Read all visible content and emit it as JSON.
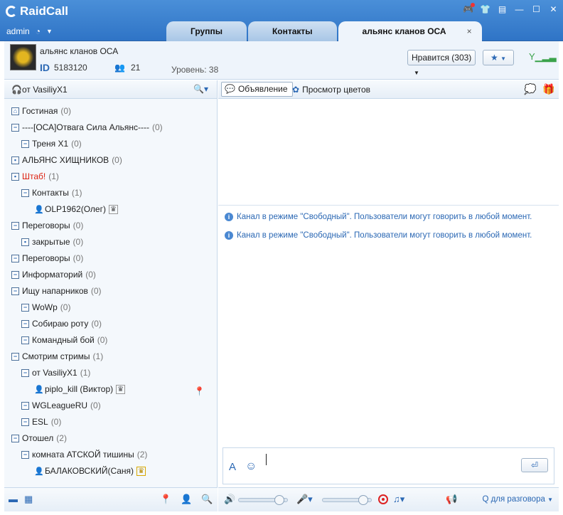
{
  "app": {
    "name": "RaidCall",
    "user": "admin"
  },
  "tabs": [
    {
      "label": "Группы"
    },
    {
      "label": "Контакты"
    },
    {
      "label": "альянс кланов ОСА",
      "close": "×"
    }
  ],
  "channel": {
    "name": "альянс кланов ОСА",
    "id_label": "ID",
    "id": "5183120",
    "members": "21",
    "level": "Уровень: 38",
    "likes": "Нравится (303)"
  },
  "left": {
    "header": "от VasiliyX1",
    "tree": [
      {
        "name": "Гостиная",
        "count": "(0)",
        "icon": "home"
      },
      {
        "name": "----[ОСА]Отвага Сила Альянс----",
        "count": "(0)",
        "icon": "minus"
      },
      {
        "name": "Треня Х1",
        "count": "(0)",
        "icon": "minus"
      },
      {
        "name": "АЛЬЯНС ХИЩНИКОВ",
        "count": "(0)",
        "icon": "lock"
      },
      {
        "name": "Штаб!",
        "count": "(1)",
        "icon": "lock"
      },
      {
        "name": "Контакты",
        "count": "(1)",
        "icon": "minus"
      },
      {
        "name": "OLP1962(Олег)",
        "count": "",
        "icon": "user"
      },
      {
        "name": "Переговоры",
        "count": "(0)",
        "icon": "minus"
      },
      {
        "name": "закрытые",
        "count": "(0)",
        "icon": "lock"
      },
      {
        "name": "Переговоры",
        "count": "(0)",
        "icon": "minus"
      },
      {
        "name": "Информаторий",
        "count": "(0)",
        "icon": "minus"
      },
      {
        "name": "Ищу напарников",
        "count": "(0)",
        "icon": "minus"
      },
      {
        "name": "WoWp",
        "count": "(0)",
        "icon": "minus"
      },
      {
        "name": "Собираю роту",
        "count": "(0)",
        "icon": "minus"
      },
      {
        "name": "Командный бой",
        "count": "(0)",
        "icon": "minus"
      },
      {
        "name": "Смотрим стримы",
        "count": "(1)",
        "icon": "minus"
      },
      {
        "name": "от VasiliyX1",
        "count": "(1)",
        "icon": "minus"
      },
      {
        "name": "piplo_kill (Виктор)",
        "count": "",
        "icon": "user"
      },
      {
        "name": "WGLeagueRU",
        "count": "(0)",
        "icon": "minus"
      },
      {
        "name": "ESL",
        "count": "(0)",
        "icon": "minus"
      },
      {
        "name": "Отошел",
        "count": "(2)",
        "icon": "minus"
      },
      {
        "name": "комната АТСКОЙ тишины",
        "count": "(2)",
        "icon": "minus"
      },
      {
        "name": "БАЛАКОВСКИЙ(Саня)",
        "count": "",
        "icon": "user"
      }
    ]
  },
  "right": {
    "announcement": "Объявление",
    "flowers": "Просмотр цветов",
    "messages": [
      "Канал в режиме \"Свободный\". Пользователи могут говорить в любой момент.",
      "Канал в режиме \"Свободный\". Пользователи могут говорить в любой момент."
    ],
    "speak_mode": "Q для разговора",
    "volume_level": 0.9,
    "mic_level": 0.9
  }
}
